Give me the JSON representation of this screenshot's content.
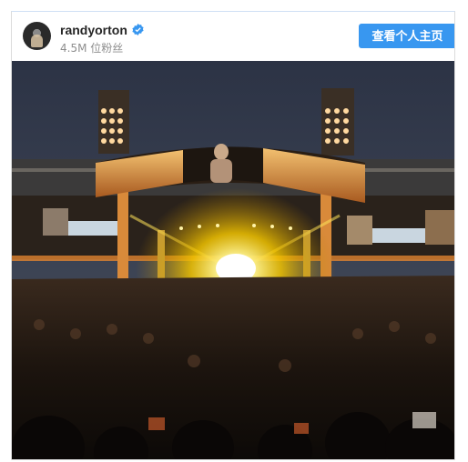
{
  "post": {
    "username": "randyorton",
    "verified_icon": "verified-badge-icon",
    "followers": "4.5M 位粉丝",
    "profile_button_label": "查看个人主页",
    "accent_color": "#3897f0"
  },
  "photo": {
    "icon": "concert-stage-photo"
  }
}
